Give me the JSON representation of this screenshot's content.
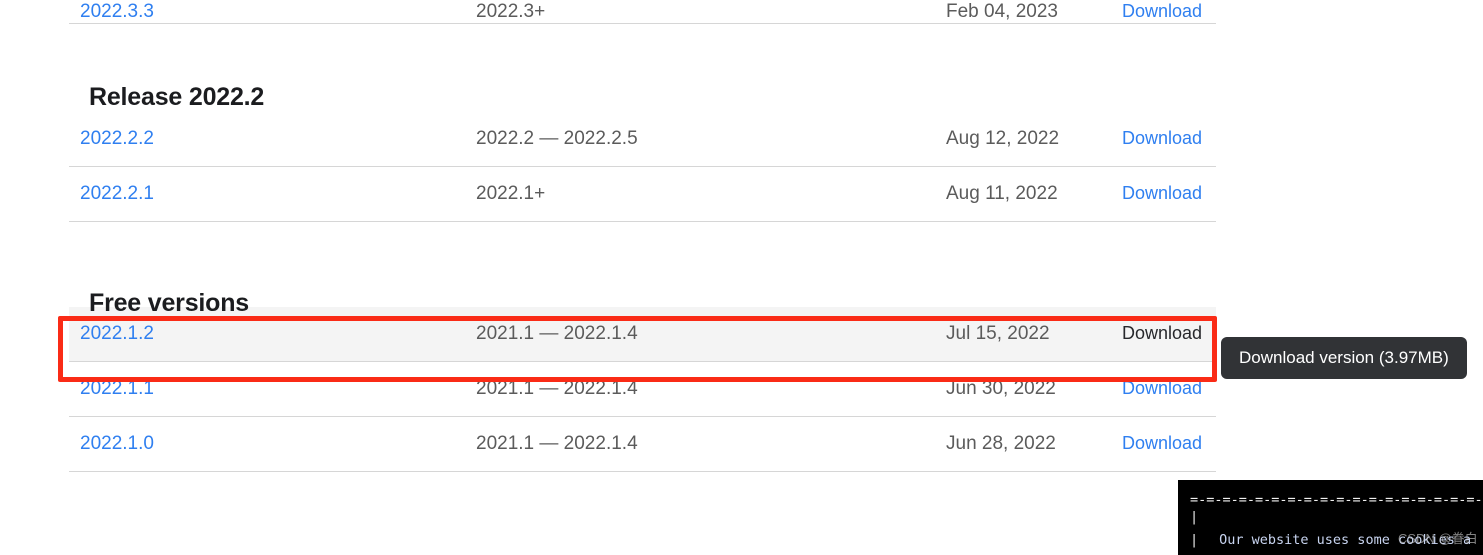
{
  "page": {
    "link_color": "#2f7ff0",
    "text_muted": "#5b5b5b",
    "heading_color": "#1b1c1f",
    "annotation_color": "#fa2b16",
    "row_hover_bg": "#f4f4f4"
  },
  "partial_top_row": {
    "version": "2022.3.3",
    "compatibility": "2022.3+",
    "date": "Feb 04, 2023",
    "action": "Download"
  },
  "sections": [
    {
      "heading": "Release 2022.2",
      "rows": [
        {
          "version": "2022.2.2",
          "compatibility": "2022.2 — 2022.2.5",
          "date": "Aug 12, 2022",
          "action": "Download",
          "hovered": false
        },
        {
          "version": "2022.2.1",
          "compatibility": "2022.1+",
          "date": "Aug 11, 2022",
          "action": "Download",
          "hovered": false
        }
      ]
    },
    {
      "heading": "Free versions",
      "rows": [
        {
          "version": "2022.1.2",
          "compatibility": "2021.1 — 2022.1.4",
          "date": "Jul 15, 2022",
          "action": "Download",
          "hovered": true
        },
        {
          "version": "2022.1.1",
          "compatibility": "2021.1 — 2022.1.4",
          "date": "Jun 30, 2022",
          "action": "Download",
          "hovered": false
        },
        {
          "version": "2022.1.0",
          "compatibility": "2021.1 — 2022.1.4",
          "date": "Jun 28, 2022",
          "action": "Download",
          "hovered": false
        }
      ]
    }
  ],
  "tooltip": {
    "label": "Download version (3.97MB)"
  },
  "terminal": {
    "separator": "=-=-=-=-=-=-=-=-=-=-=-=-=-=-=-=-=-=-=-=-=",
    "bar": "|",
    "text": "Our website uses some cookies a"
  },
  "watermark": {
    "text": "CSDN @眷白"
  }
}
